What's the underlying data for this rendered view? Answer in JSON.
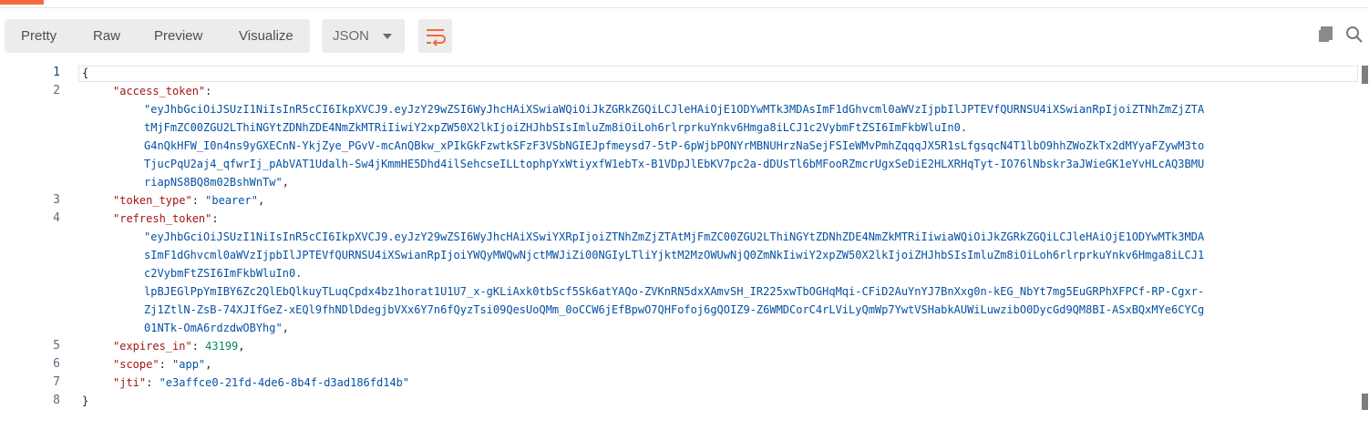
{
  "tabs": {
    "pretty": "Pretty",
    "raw": "Raw",
    "preview": "Preview",
    "visualize": "Visualize"
  },
  "format_select": {
    "value": "JSON"
  },
  "icons": {
    "wrap": "wrap-lines-icon",
    "copy": "copy-icon",
    "search": "search-icon"
  },
  "colors": {
    "accent": "#f26b3a",
    "key": "#a31515",
    "string": "#0451a5",
    "number": "#098658"
  },
  "line_numbers": [
    "1",
    "2",
    "3",
    "4",
    "5",
    "6",
    "7",
    "8"
  ],
  "json": {
    "open_brace": "{",
    "close_brace": "}",
    "access_token_key": "\"access_token\"",
    "access_token_lines": [
      "\"eyJhbGciOiJSUzI1NiIsInR5cCI6IkpXVCJ9.eyJzY29wZSI6WyJhcHAiXSwiaWQiOiJkZGRkZGQiLCJleHAiOjE1ODYwMTk3MDAsImF1dGhvcml0aWVzIjpbIlJPTEVfQURNSU4iXSwianRpIjoiZTNhZmZjZTA",
      "tMjFmZC00ZGU2LThiNGYtZDNhZDE4NmZkMTRiIiwiY2xpZW50X2lkIjoiZHJhbSIsImluZm8iOiLoh6rlrprkuYnkv6Hmga8iLCJ1c2VybmFtZSI6ImFkbWluIn0.",
      "G4nQkHFW_I0n4ns9yGXECnN-YkjZye_PGvV-mcAnQBkw_xPIkGkFzwtkSFzF3VSbNGIEJpfmeysd7-5tP-6pWjbPONYrMBNUHrzNaSejFSIeWMvPmhZqqqJX5R1sLfgsqcN4T1lbO9hhZWoZkTx2dMYyaFZywM3to",
      "TjucPqU2aj4_qfwrIj_pAbVAT1Udalh-Sw4jKmmHE5Dhd4ilSehcseILLtophpYxWtiyxfW1ebTx-B1VDpJlEbKV7pc2a-dDUsTl6bMFooRZmcrUgxSeDiE2HLXRHqTyt-IO76lNbskr3aJWieGK1eYvHLcAQ3BMU",
      "riapNS8BQ8m02BshWnTw\""
    ],
    "token_type_key": "\"token_type\"",
    "token_type_val": "\"bearer\"",
    "refresh_token_key": "\"refresh_token\"",
    "refresh_token_lines": [
      "\"eyJhbGciOiJSUzI1NiIsInR5cCI6IkpXVCJ9.eyJzY29wZSI6WyJhcHAiXSwiYXRpIjoiZTNhZmZjZTAtMjFmZC00ZGU2LThiNGYtZDNhZDE4NmZkMTRiIiwiaWQiOiJkZGRkZGQiLCJleHAiOjE1ODYwMTk3MDA",
      "sImF1dGhvcml0aWVzIjpbIlJPTEVfQURNSU4iXSwianRpIjoiYWQyMWQwNjctMWJiZi00NGIyLTliYjktM2MzOWUwNjQ0ZmNkIiwiY2xpZW50X2lkIjoiZHJhbSIsImluZm8iOiLoh6rlrprkuYnkv6Hmga8iLCJ1",
      "c2VybmFtZSI6ImFkbWluIn0.",
      "lpBJEGlPpYmIBY6Zc2QlEbQlkuyTLuqCpdx4bz1horat1U1U7_x-gKLiAxk0tbScf5Sk6atYAQo-ZVKnRN5dxXAmvSH_IR225xwTbOGHqMqi-CFiD2AuYnYJ7BnXxg0n-kEG_NbYt7mg5EuGRPhXFPCf-RP-Cgxr-",
      "Zj1ZtlN-ZsB-74XJIfGeZ-xEQl9fhNDlDdegjbVXx6Y7n6fQyzTsi09QesUoQMm_0oCCW6jEfBpwO7QHFofoj6gQOIZ9-Z6WMDCorC4rLViLyQmWp7YwtVSHabkAUWiLuwzibO0DycGd9QM8BI-ASxBQxMYe6CYCg",
      "01NTk-OmA6rdzdwOBYhg\""
    ],
    "expires_in_key": "\"expires_in\"",
    "expires_in_val": "43199",
    "scope_key": "\"scope\"",
    "scope_val": "\"app\"",
    "jti_key": "\"jti\"",
    "jti_val": "\"e3affce0-21fd-4de6-8b4f-d3ad186fd14b\""
  }
}
